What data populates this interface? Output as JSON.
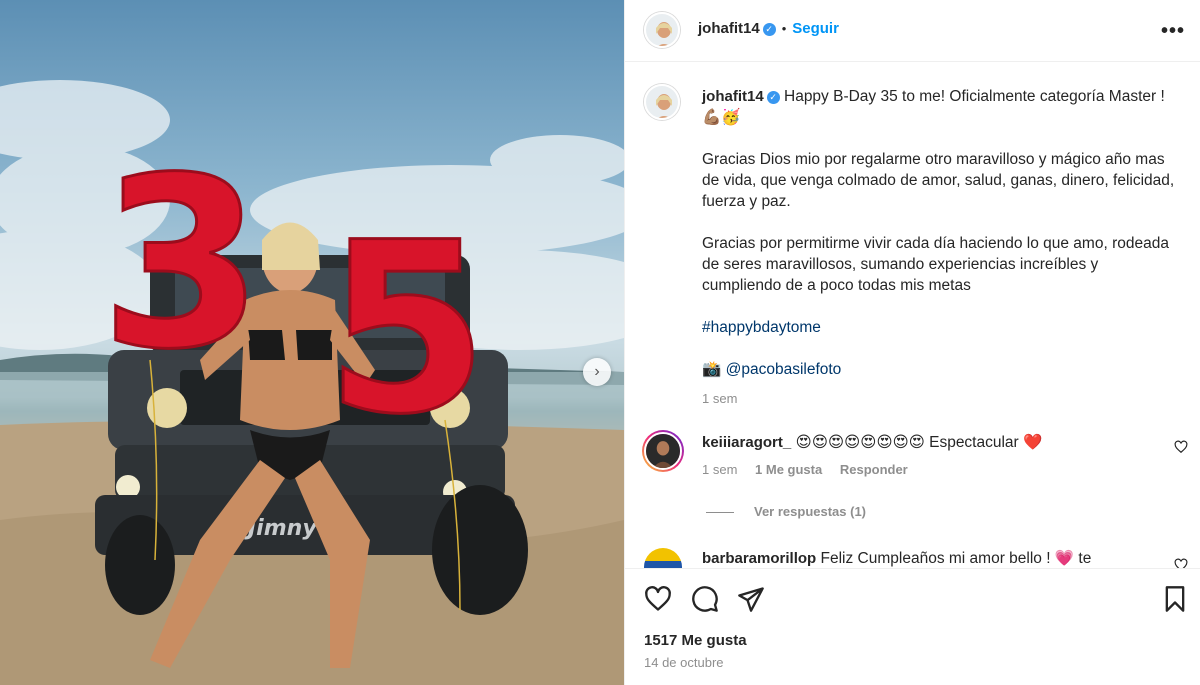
{
  "post": {
    "username": "johafit14",
    "follow_label": "Seguir",
    "separator": "•",
    "more_label": "•••",
    "caption": {
      "line1": "Happy B-Day 35 to me! Oficialmente categoría Master ! 💪🏽🥳",
      "paragraph2": "Gracias Dios mio por regalarme otro maravilloso y mágico año mas de vida, que venga colmado de amor, salud, ganas, dinero, felicidad, fuerza y paz.",
      "paragraph3": "Gracias por permitirme vivir cada día haciendo lo que amo, rodeada de seres maravillosos, sumando experiencias increíbles y cumpliendo de a poco todas mis metas",
      "hashtag": "#happybdaytome",
      "credit": "📸 @pacobasilefoto",
      "time": "1 sem"
    },
    "comments": [
      {
        "username": "keiiiaragort_",
        "text": "😍😍😍😍😍😍😍😍 Espectacular ❤️",
        "time": "1 sem",
        "likes_label": "1 Me gusta",
        "reply_label": "Responder",
        "replies_label": "Ver respuestas (1)"
      },
      {
        "username": "barbaramorillop",
        "text": "Feliz Cumpleaños mi amor bello ! 💗 te"
      }
    ],
    "likes_label": "1517 Me gusta",
    "date_label": "14 de octubre",
    "next_label": "›"
  },
  "colors": {
    "accent": "#0095f6",
    "verified": "#3897f0",
    "muted": "#8e8e8e",
    "balloon": "#d8142a"
  },
  "icons": {
    "like": "heart-icon",
    "comment": "comment-icon",
    "share": "paper-plane-icon",
    "save": "bookmark-icon",
    "comment_like": "small-heart-icon",
    "more": "more-options-icon",
    "next": "chevron-right-icon",
    "verified": "verified-badge-icon"
  }
}
